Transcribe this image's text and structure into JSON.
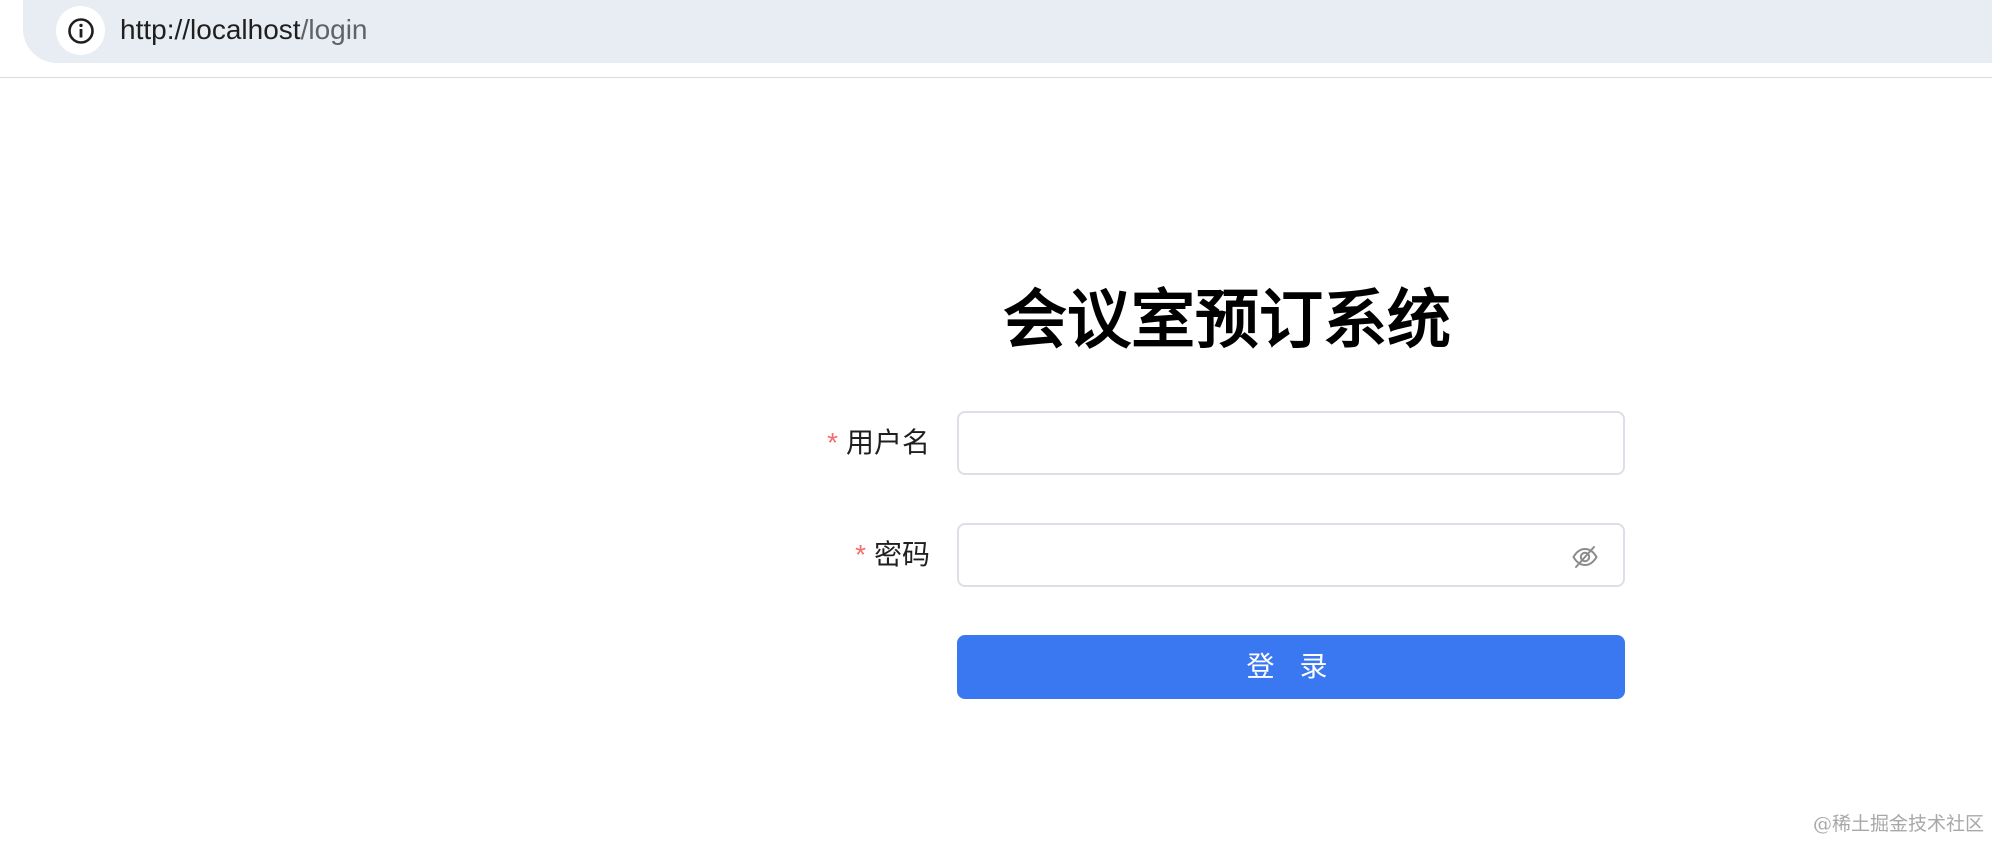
{
  "browser": {
    "url_host": "http://localhost",
    "url_path": "/login",
    "info_icon": "info-icon"
  },
  "login": {
    "title": "会议室预订系统",
    "username": {
      "required_mark": "*",
      "label": "用户名",
      "value": "",
      "placeholder": ""
    },
    "password": {
      "required_mark": "*",
      "label": "密码",
      "value": "",
      "placeholder": "",
      "toggle_icon": "eye-off-icon"
    },
    "submit_label": "登 录",
    "accent_color": "#3a78f2",
    "required_color": "#f56c6c"
  },
  "watermark": "@稀土掘金技术社区"
}
